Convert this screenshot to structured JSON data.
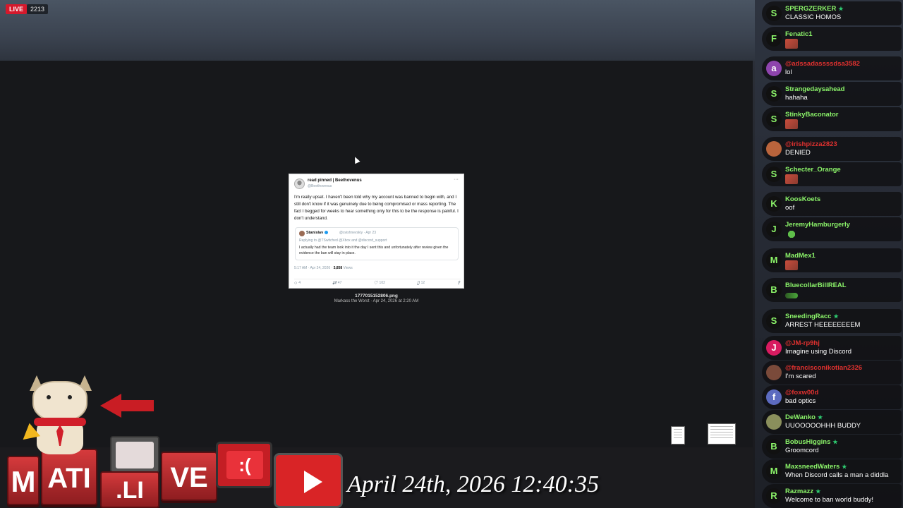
{
  "stream": {
    "live_label": "LIVE",
    "viewer_count": "2213"
  },
  "tweet": {
    "display_name": "read pinned | Beethovenus",
    "handle": "@Beethovenus",
    "more": "···",
    "body": "I'm really upset. I haven't been told why my account was banned to begin with, and I still don't know if it was genuinely due to being compromised or mass reporting. The fact I begged for weeks to hear something only for this to be the response is painful. I don't understand.",
    "quote": {
      "name": "Stanislav",
      "meta": "@svishnevskiy · Apr 23",
      "replying": "Replying to @TSwitched @Xbox and @discord_support",
      "body": "I actually had the team look into it the day I sent this and unfortunately after review given the evidence the ban will stay in place."
    },
    "timestamp": "5:17 AM · Apr 24, 2026 · ",
    "views_count": "3,858",
    "views_label": " Views",
    "actions": {
      "replies": "4",
      "retweets": "47",
      "likes": "102",
      "bookmarks": "12"
    }
  },
  "attachment": {
    "filename": "1777015152806.png",
    "meta": "Markass the Worst · Apr 24, 2026 at 2:20 AM"
  },
  "overlay": {
    "date_text": "April 24th, 2026 12:40:35",
    "logo_letters": [
      "M",
      "ATI",
      ".LI",
      "VE"
    ]
  },
  "chat": {
    "messages": [
      {
        "initial": "S",
        "user": "SPERGZERKER",
        "badge": true,
        "text": "CLASSIC HOMOS",
        "user_color": "#8cf56a",
        "avatar_bg": "#111",
        "emote": null
      },
      {
        "initial": "F",
        "user": "Fenatic1",
        "badge": false,
        "text": "",
        "user_color": "#8cf56a",
        "avatar_bg": "#111",
        "emote": "red"
      },
      {
        "initial": "a",
        "user": "@adssadassssdsa3582",
        "badge": false,
        "text": "lol",
        "user_color": "#e0312f",
        "avatar_bg": "#8e44ad",
        "emote": null
      },
      {
        "initial": "S",
        "user": "Strangedaysahead",
        "badge": false,
        "text": "hahaha",
        "user_color": "#8cf56a",
        "avatar_bg": "#111",
        "emote": null
      },
      {
        "initial": "S",
        "user": "StinkyBaconator",
        "badge": false,
        "text": "",
        "user_color": "#8cf56a",
        "avatar_bg": "#111",
        "emote": "red"
      },
      {
        "initial": "",
        "user": "@irishpizza2823",
        "badge": false,
        "text": "DENIED",
        "user_color": "#e0312f",
        "avatar_bg": "#b9643c",
        "emote": null
      },
      {
        "initial": "S",
        "user": "Schecter_Orange",
        "badge": false,
        "text": "",
        "user_color": "#8cf56a",
        "avatar_bg": "#111",
        "emote": "red"
      },
      {
        "initial": "K",
        "user": "KoosKoets",
        "badge": false,
        "text": "oof",
        "user_color": "#8cf56a",
        "avatar_bg": "#111",
        "emote": null
      },
      {
        "initial": "J",
        "user": "JeremyHamburgerly",
        "badge": false,
        "text": "",
        "user_color": "#8cf56a",
        "avatar_bg": "#111",
        "emote": "green"
      },
      {
        "initial": "M",
        "user": "MadMex1",
        "badge": false,
        "text": "",
        "user_color": "#8cf56a",
        "avatar_bg": "#111",
        "emote": "red"
      },
      {
        "initial": "B",
        "user": "BluecollarBillREAL",
        "badge": false,
        "text": "",
        "user_color": "#8cf56a",
        "avatar_bg": "#111",
        "emote": "pepe"
      },
      {
        "initial": "S",
        "user": "SneedingRacc",
        "badge": true,
        "text": "ARREST HEEEEEEEEM",
        "user_color": "#8cf56a",
        "avatar_bg": "#111",
        "emote": null
      },
      {
        "initial": "J",
        "user": "@JM-rp9hj",
        "badge": false,
        "text": "Imagine using Discord",
        "user_color": "#e0312f",
        "avatar_bg": "#d81b60",
        "emote": null
      },
      {
        "initial": "",
        "user": "@francisconikotian2326",
        "badge": false,
        "text": "I'm scared",
        "user_color": "#e0312f",
        "avatar_bg": "#7a4a3a",
        "emote": null
      },
      {
        "initial": "f",
        "user": "@foxw00d",
        "badge": false,
        "text": "bad optics",
        "user_color": "#e0312f",
        "avatar_bg": "#5c6bc0",
        "emote": null
      },
      {
        "initial": "",
        "user": "DeWanko",
        "badge": true,
        "text": "UUOOOOOHHH BUDDY",
        "user_color": "#8cf56a",
        "avatar_bg": "#8a8f5c",
        "emote": null
      },
      {
        "initial": "B",
        "user": "BobusHiggins",
        "badge": true,
        "text": "Groomcord",
        "user_color": "#8cf56a",
        "avatar_bg": "#111",
        "emote": null
      },
      {
        "initial": "M",
        "user": "MaxsneedWaters",
        "badge": true,
        "text": "When Discord calls a man a diddla",
        "user_color": "#8cf56a",
        "avatar_bg": "#111",
        "emote": null
      },
      {
        "initial": "R",
        "user": "Razmazz",
        "badge": true,
        "text": "Welcome to ban world buddy!",
        "user_color": "#8cf56a",
        "avatar_bg": "#111",
        "emote": null
      }
    ]
  }
}
